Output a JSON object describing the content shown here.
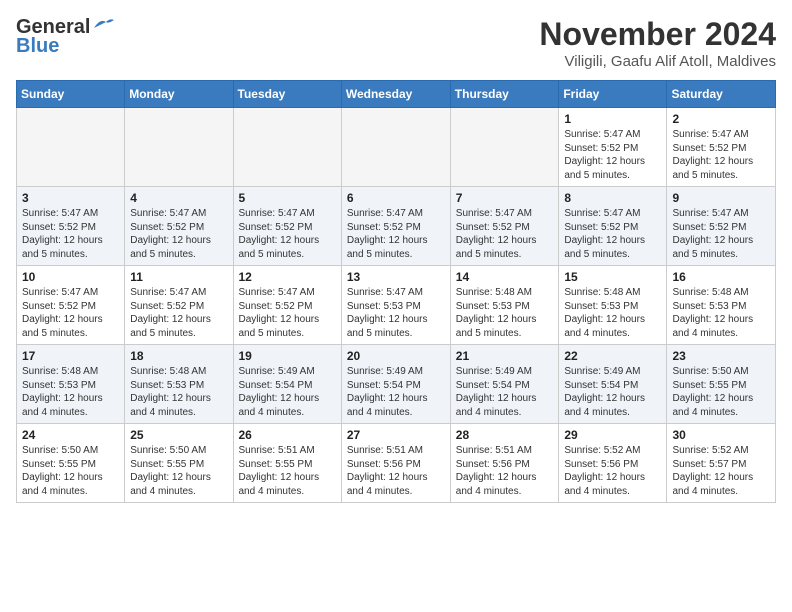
{
  "header": {
    "logo_general": "General",
    "logo_blue": "Blue",
    "month_year": "November 2024",
    "location": "Viligili, Gaafu Alif Atoll, Maldives"
  },
  "weekdays": [
    "Sunday",
    "Monday",
    "Tuesday",
    "Wednesday",
    "Thursday",
    "Friday",
    "Saturday"
  ],
  "weeks": [
    [
      {
        "day": "",
        "info": ""
      },
      {
        "day": "",
        "info": ""
      },
      {
        "day": "",
        "info": ""
      },
      {
        "day": "",
        "info": ""
      },
      {
        "day": "",
        "info": ""
      },
      {
        "day": "1",
        "info": "Sunrise: 5:47 AM\nSunset: 5:52 PM\nDaylight: 12 hours\nand 5 minutes."
      },
      {
        "day": "2",
        "info": "Sunrise: 5:47 AM\nSunset: 5:52 PM\nDaylight: 12 hours\nand 5 minutes."
      }
    ],
    [
      {
        "day": "3",
        "info": "Sunrise: 5:47 AM\nSunset: 5:52 PM\nDaylight: 12 hours\nand 5 minutes."
      },
      {
        "day": "4",
        "info": "Sunrise: 5:47 AM\nSunset: 5:52 PM\nDaylight: 12 hours\nand 5 minutes."
      },
      {
        "day": "5",
        "info": "Sunrise: 5:47 AM\nSunset: 5:52 PM\nDaylight: 12 hours\nand 5 minutes."
      },
      {
        "day": "6",
        "info": "Sunrise: 5:47 AM\nSunset: 5:52 PM\nDaylight: 12 hours\nand 5 minutes."
      },
      {
        "day": "7",
        "info": "Sunrise: 5:47 AM\nSunset: 5:52 PM\nDaylight: 12 hours\nand 5 minutes."
      },
      {
        "day": "8",
        "info": "Sunrise: 5:47 AM\nSunset: 5:52 PM\nDaylight: 12 hours\nand 5 minutes."
      },
      {
        "day": "9",
        "info": "Sunrise: 5:47 AM\nSunset: 5:52 PM\nDaylight: 12 hours\nand 5 minutes."
      }
    ],
    [
      {
        "day": "10",
        "info": "Sunrise: 5:47 AM\nSunset: 5:52 PM\nDaylight: 12 hours\nand 5 minutes."
      },
      {
        "day": "11",
        "info": "Sunrise: 5:47 AM\nSunset: 5:52 PM\nDaylight: 12 hours\nand 5 minutes."
      },
      {
        "day": "12",
        "info": "Sunrise: 5:47 AM\nSunset: 5:52 PM\nDaylight: 12 hours\nand 5 minutes."
      },
      {
        "day": "13",
        "info": "Sunrise: 5:47 AM\nSunset: 5:53 PM\nDaylight: 12 hours\nand 5 minutes."
      },
      {
        "day": "14",
        "info": "Sunrise: 5:48 AM\nSunset: 5:53 PM\nDaylight: 12 hours\nand 5 minutes."
      },
      {
        "day": "15",
        "info": "Sunrise: 5:48 AM\nSunset: 5:53 PM\nDaylight: 12 hours\nand 4 minutes."
      },
      {
        "day": "16",
        "info": "Sunrise: 5:48 AM\nSunset: 5:53 PM\nDaylight: 12 hours\nand 4 minutes."
      }
    ],
    [
      {
        "day": "17",
        "info": "Sunrise: 5:48 AM\nSunset: 5:53 PM\nDaylight: 12 hours\nand 4 minutes."
      },
      {
        "day": "18",
        "info": "Sunrise: 5:48 AM\nSunset: 5:53 PM\nDaylight: 12 hours\nand 4 minutes."
      },
      {
        "day": "19",
        "info": "Sunrise: 5:49 AM\nSunset: 5:54 PM\nDaylight: 12 hours\nand 4 minutes."
      },
      {
        "day": "20",
        "info": "Sunrise: 5:49 AM\nSunset: 5:54 PM\nDaylight: 12 hours\nand 4 minutes."
      },
      {
        "day": "21",
        "info": "Sunrise: 5:49 AM\nSunset: 5:54 PM\nDaylight: 12 hours\nand 4 minutes."
      },
      {
        "day": "22",
        "info": "Sunrise: 5:49 AM\nSunset: 5:54 PM\nDaylight: 12 hours\nand 4 minutes."
      },
      {
        "day": "23",
        "info": "Sunrise: 5:50 AM\nSunset: 5:55 PM\nDaylight: 12 hours\nand 4 minutes."
      }
    ],
    [
      {
        "day": "24",
        "info": "Sunrise: 5:50 AM\nSunset: 5:55 PM\nDaylight: 12 hours\nand 4 minutes."
      },
      {
        "day": "25",
        "info": "Sunrise: 5:50 AM\nSunset: 5:55 PM\nDaylight: 12 hours\nand 4 minutes."
      },
      {
        "day": "26",
        "info": "Sunrise: 5:51 AM\nSunset: 5:55 PM\nDaylight: 12 hours\nand 4 minutes."
      },
      {
        "day": "27",
        "info": "Sunrise: 5:51 AM\nSunset: 5:56 PM\nDaylight: 12 hours\nand 4 minutes."
      },
      {
        "day": "28",
        "info": "Sunrise: 5:51 AM\nSunset: 5:56 PM\nDaylight: 12 hours\nand 4 minutes."
      },
      {
        "day": "29",
        "info": "Sunrise: 5:52 AM\nSunset: 5:56 PM\nDaylight: 12 hours\nand 4 minutes."
      },
      {
        "day": "30",
        "info": "Sunrise: 5:52 AM\nSunset: 5:57 PM\nDaylight: 12 hours\nand 4 minutes."
      }
    ]
  ]
}
